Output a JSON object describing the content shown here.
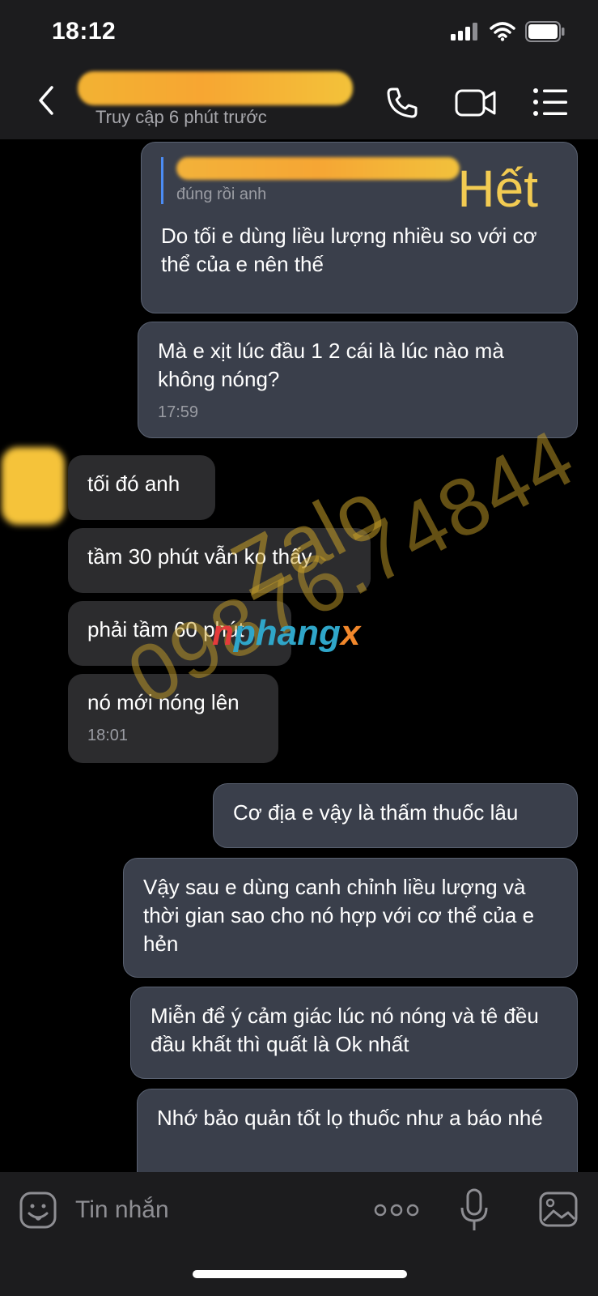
{
  "status_bar": {
    "time": "18:12"
  },
  "header": {
    "contact_status": "Truy cập 6 phút trước"
  },
  "messages": [
    {
      "direction": "out",
      "quote_text": "đúng rồi anh",
      "text": "Do tối e dùng liều lượng nhiều so với cơ thể của e nên thế",
      "sticker_text": "Hết"
    },
    {
      "direction": "out",
      "text": "Mà e xịt lúc đầu 1 2 cái là lúc nào mà không nóng?",
      "time": "17:59"
    },
    {
      "direction": "in",
      "text": "tối đó anh"
    },
    {
      "direction": "in",
      "text": "tầm 30 phút vẫn ko thấy"
    },
    {
      "direction": "in",
      "text": "phải tầm 60 phút"
    },
    {
      "direction": "in",
      "text": "nó mới nóng lên",
      "time": "18:01"
    },
    {
      "direction": "out",
      "text": "Cơ địa e vậy là thấm thuốc lâu"
    },
    {
      "direction": "out",
      "text": "Vậy sau e dùng canh chỉnh liều lượng và thời gian sao cho nó hợp với cơ thể của e hẻn"
    },
    {
      "direction": "out",
      "text": "Miễn để ý cảm giác lúc nó nóng và tê đều đầu khất thì quất là Ok nhất"
    },
    {
      "direction": "out",
      "text": "Nhớ bảo quản tốt lọ thuốc như a báo nhé"
    }
  ],
  "watermark": {
    "line1": "Zalo",
    "line2": "09876.74844",
    "logo_part1": "n",
    "logo_part2": "phang",
    "logo_part3": "x"
  },
  "composer": {
    "placeholder": "Tin nhắn"
  },
  "colors": {
    "outgoing_bubble": "#3a3f4b",
    "incoming_bubble": "#2c2c2e",
    "accent": "#4b8cf5"
  }
}
